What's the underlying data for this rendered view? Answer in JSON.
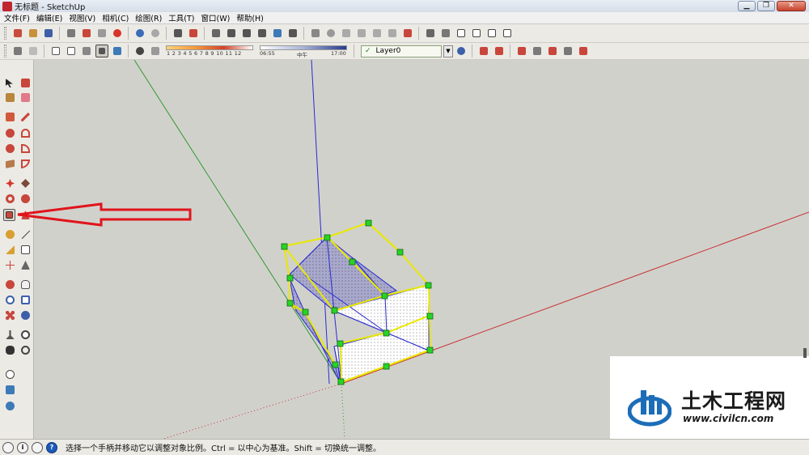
{
  "window": {
    "title": "无标题 - SketchUp",
    "minimize": "▁",
    "restore": "❐",
    "close": "✕"
  },
  "menu": [
    "文件(F)",
    "编辑(E)",
    "视图(V)",
    "相机(C)",
    "绘图(R)",
    "工具(T)",
    "窗口(W)",
    "帮助(H)"
  ],
  "shadow_settings": {
    "month_ticks": "1  2  3  4  5  6  7  8  9  10 11 12"
  },
  "time_settings": {
    "start": "06:55",
    "middle": "中午",
    "end": "17:00"
  },
  "layer": {
    "current": "Layer0",
    "check": "✓",
    "dropdown": "▼"
  },
  "status": {
    "message": "选择一个手柄并移动它以调整对象比例。Ctrl = 以中心为基准。Shift = 切换统一调整。",
    "icon_info": "i",
    "icon_help": "?"
  },
  "watermark": {
    "name": "土木工程网",
    "url": "www.civilcn.com"
  },
  "colors": {
    "axis_red": "#c83232",
    "axis_green": "#2f9a2f",
    "axis_blue": "#2a2ad0",
    "selection": "#e8e800",
    "grip": "#27d327",
    "annotation_arrow": "#e0141a",
    "face": "#ffffff",
    "face_back": "#a9a9cf"
  }
}
